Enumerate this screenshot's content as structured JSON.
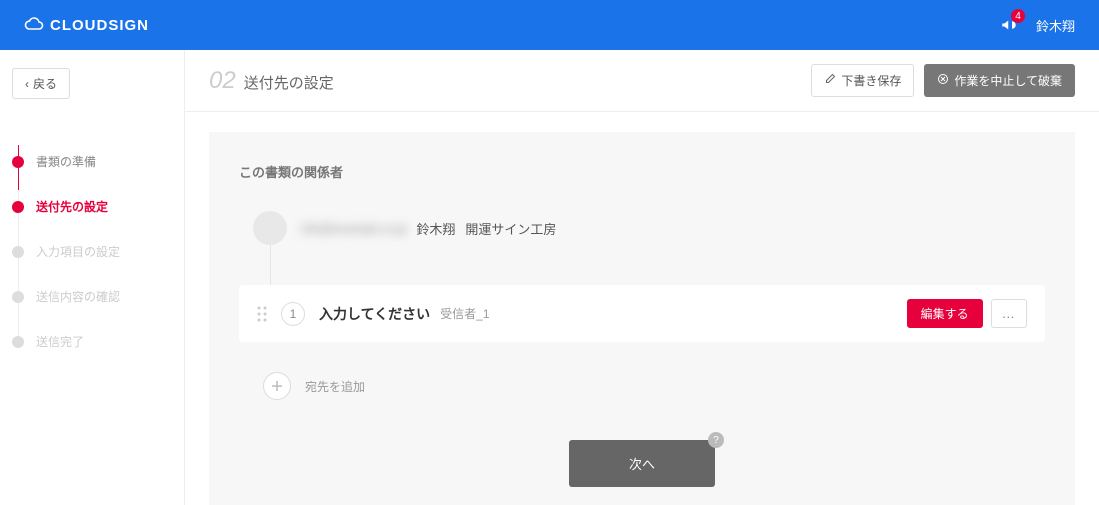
{
  "header": {
    "brand": "CLOUDSIGN",
    "notification_count": "4",
    "user_name": "鈴木翔"
  },
  "sidebar": {
    "back_label": "戻る",
    "steps": [
      {
        "label": "書類の準備",
        "state": "done"
      },
      {
        "label": "送付先の設定",
        "state": "active"
      },
      {
        "label": "入力項目の設定",
        "state": "pending"
      },
      {
        "label": "送信内容の確認",
        "state": "pending"
      },
      {
        "label": "送信完了",
        "state": "pending"
      }
    ]
  },
  "page": {
    "number": "02",
    "title": "送付先の設定",
    "save_draft": "下書き保存",
    "discard": "作業を中止して破棄"
  },
  "panel": {
    "title": "この書類の関係者",
    "sender": {
      "email_blurred": "info@example.co.jp",
      "name": "鈴木翔",
      "company": "開運サイン工房"
    },
    "recipient": {
      "number": "1",
      "placeholder": "入力してください",
      "role": "受信者_1",
      "edit": "編集する",
      "more": "…"
    },
    "add_recipient": "宛先を追加",
    "next": "次へ",
    "help": "?"
  }
}
